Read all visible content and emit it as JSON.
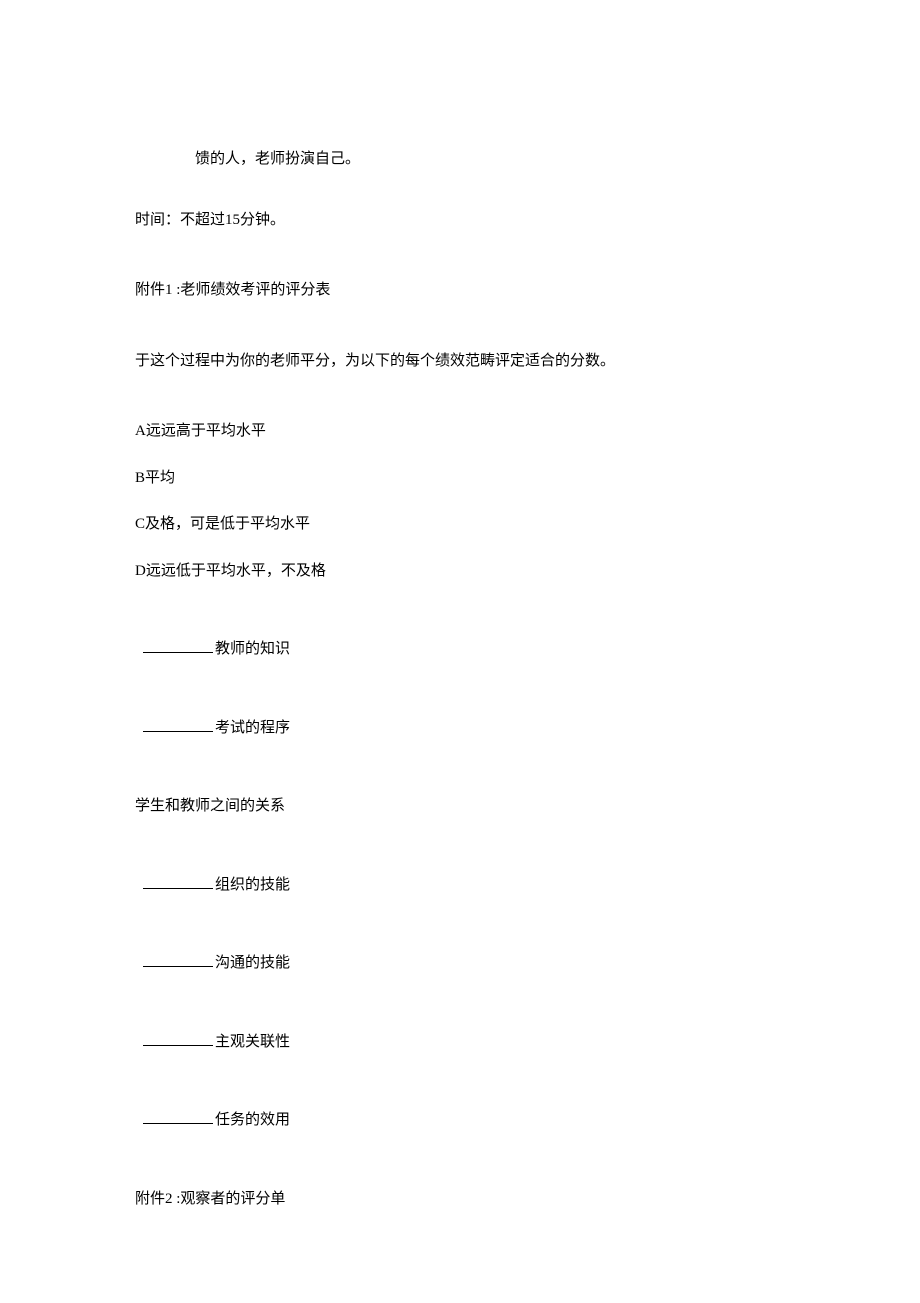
{
  "top_fragment": "馈的人，老师扮演自己。",
  "time_line": "时间：不超过15分钟。",
  "attachment1_title": "附件1 :老师绩效考评的评分表",
  "instruction": "于这个过程中为你的老师平分，为以下的每个绩效范畴评定适合的分数。",
  "scale": {
    "a": "A远远高于平均水平",
    "b": "B平均",
    "c": "C及格，可是低于平均水平",
    "d": "D远远低于平均水平，不及格"
  },
  "items": {
    "i1": "教师的知识",
    "i2": "考试的程序",
    "i3": "学生和教师之间的关系",
    "i4": "组织的技能",
    "i5": "沟通的技能",
    "i6": "主观关联性",
    "i7": "任务的效用"
  },
  "attachment2_title": "附件2 :观察者的评分单"
}
